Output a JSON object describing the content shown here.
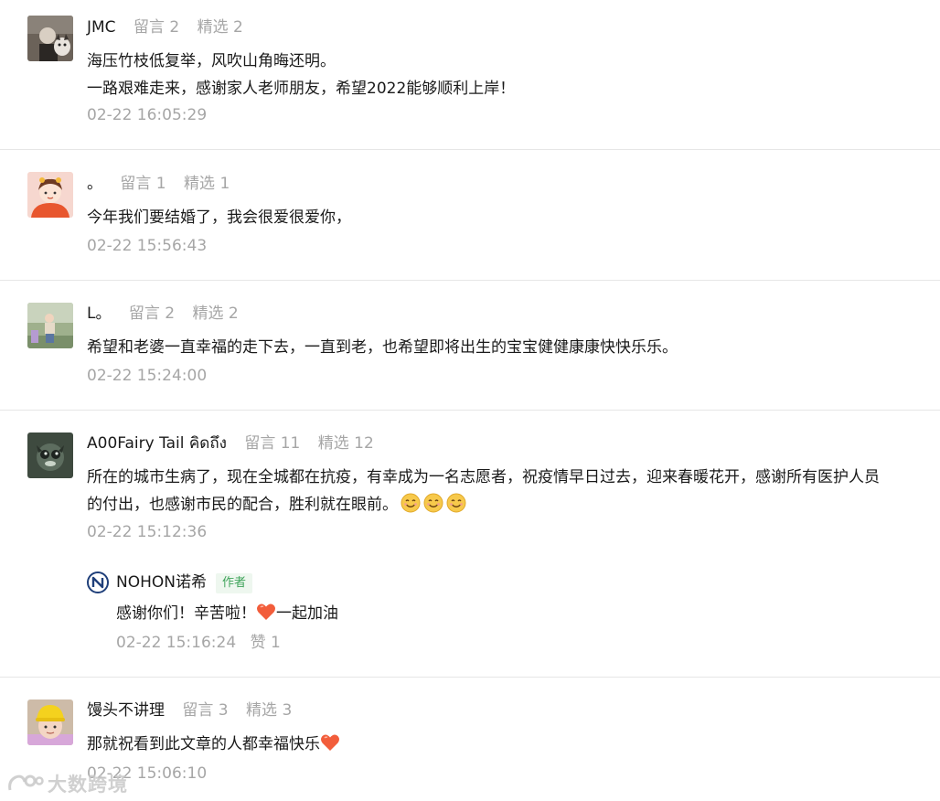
{
  "comments": [
    {
      "nickname": "JMC",
      "messages_label": "留言 2",
      "featured_label": "精选 2",
      "lines": [
        "海压竹枝低复举，风吹山角晦还明。",
        "一路艰难走来，感谢家人老师朋友，希望2022能够顺利上岸！"
      ],
      "time": "02-22 16:05:29"
    },
    {
      "nickname": "。",
      "messages_label": "留言 1",
      "featured_label": "精选 1",
      "lines": [
        "今年我们要结婚了，我会很爱很爱你，"
      ],
      "time": "02-22 15:56:43"
    },
    {
      "nickname": "L。",
      "messages_label": "留言 2",
      "featured_label": "精选 2",
      "lines": [
        "希望和老婆一直幸福的走下去，一直到老，也希望即将出生的宝宝健健康康快快乐乐。"
      ],
      "time": "02-22 15:24:00"
    },
    {
      "nickname": "A00Fairy Tail คิดถึง",
      "messages_label": "留言 11",
      "featured_label": "精选 12",
      "lines": [
        "所在的城市生病了，现在全城都在抗疫，有幸成为一名志愿者，祝疫情早日过去，迎来春暖花开，感谢所有医护人员",
        "的付出，也感谢市民的配合，胜利就在眼前。"
      ],
      "emojis": [
        "smile-emoji",
        "smile-emoji",
        "smile-emoji"
      ],
      "time": "02-22 15:12:36",
      "reply": {
        "author_name": "NOHON诺希",
        "author_tag": "作者",
        "text_before": "感谢你们！辛苦啦！",
        "text_after": "一起加油",
        "time": "02-22 15:16:24",
        "like_label": "赞 1"
      }
    },
    {
      "nickname": "馒头不讲理",
      "messages_label": "留言 3",
      "featured_label": "精选 3",
      "lines": [
        "那就祝看到此文章的人都幸福快乐"
      ],
      "time": "02-22 15:06:10"
    }
  ],
  "watermark": {
    "text": "大数跨境"
  },
  "colors": {
    "meta_gray": "#a6a6a6",
    "text": "#1a1a1a",
    "divider": "#e6e6e6",
    "author_tag_bg": "#eef7ef",
    "author_tag_text": "#3fa45a",
    "heart": "#f25d3b"
  }
}
